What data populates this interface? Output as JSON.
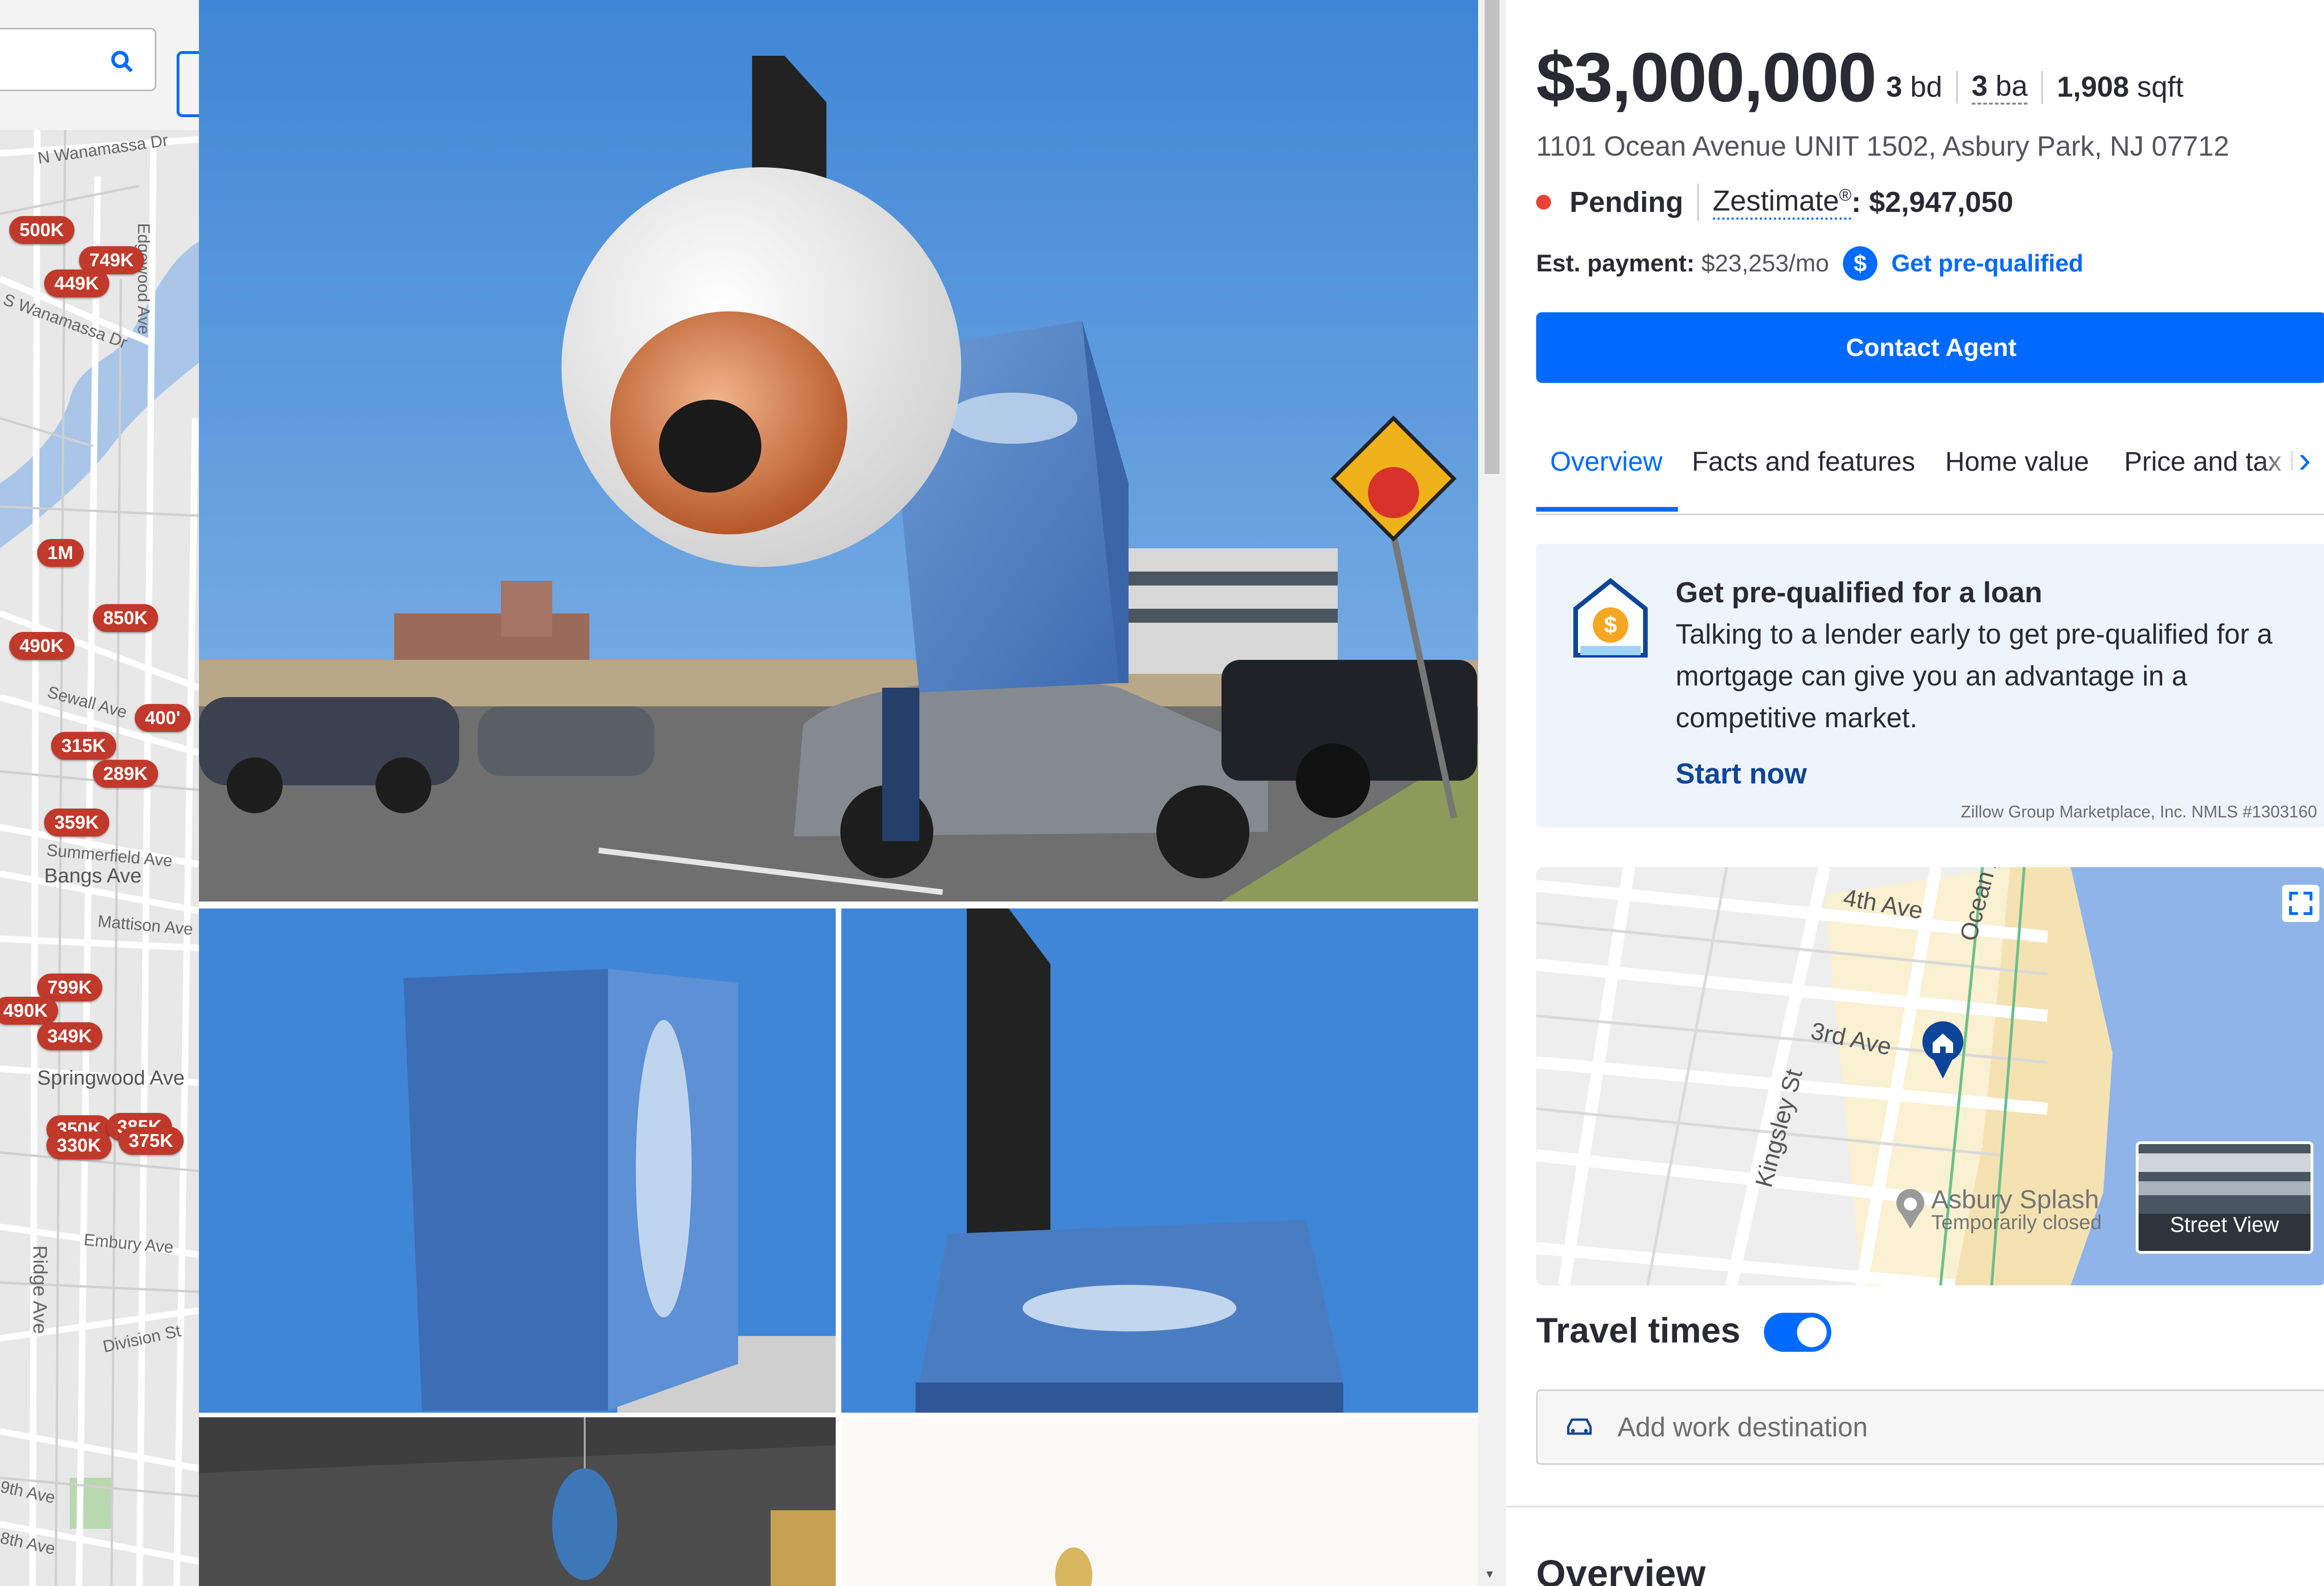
{
  "map": {
    "pins": [
      "500K",
      "749K",
      "449K",
      "1M",
      "850K",
      "490K",
      "400'",
      "315K",
      "289K",
      "359K",
      "799K",
      "490K",
      "349K",
      "350K",
      "385K",
      "330K",
      "375K"
    ],
    "streets": [
      "N Wanamassa Dr",
      "S Wanamassa Dr",
      "Sewall Ave",
      "Summerfield Ave",
      "Bangs Ave",
      "Mattison Ave",
      "Springwood Ave",
      "Embury Ave",
      "Division St",
      "Ridge Ave",
      "Edgewood Ave",
      "8th Ave",
      "9th Ave"
    ]
  },
  "listing": {
    "price": "$3,000,000",
    "beds_value": "3",
    "beds_unit": "bd",
    "baths_value": "3",
    "baths_unit": "ba",
    "sqft_value": "1,908",
    "sqft_unit": "sqft",
    "address": "1101 Ocean Avenue UNIT 1502, Asbury Park, NJ 07712",
    "status": "Pending",
    "zestimate_label": "Zestimate",
    "zestimate_reg": "®",
    "zestimate_value": ": $2,947,050",
    "payment_label": "Est. payment:",
    "payment_value": "$23,253/mo",
    "prequal_link": "Get pre-qualified",
    "contact_button": "Contact Agent",
    "status_color": "#e94235",
    "accent": "#006aff"
  },
  "tabs": [
    "Overview",
    "Facts and features",
    "Home value",
    "Price and tax h"
  ],
  "loan": {
    "title": "Get pre-qualified for a loan",
    "body": "Talking to a lender early to get pre-qualified for a mortgage can give you an advantage in a competitive market.",
    "link": "Start now",
    "legal": "Zillow Group Marketplace, Inc. NMLS #1303160"
  },
  "map_preview": {
    "streets": [
      "4th Ave",
      "Ocean Av",
      "3rd Ave",
      "Kingsley St"
    ],
    "poi_name": "Asbury Splash",
    "poi_status": "Temporarily closed",
    "street_view": "Street View"
  },
  "travel": {
    "title": "Travel times",
    "toggle_on": true,
    "placeholder": "Add work destination"
  },
  "section_heading": "Overview",
  "icons": [
    "search-icon",
    "dollar-icon",
    "house-dollar-icon",
    "chevron-right-icon",
    "expand-icon",
    "home-pin-icon",
    "car-icon"
  ]
}
